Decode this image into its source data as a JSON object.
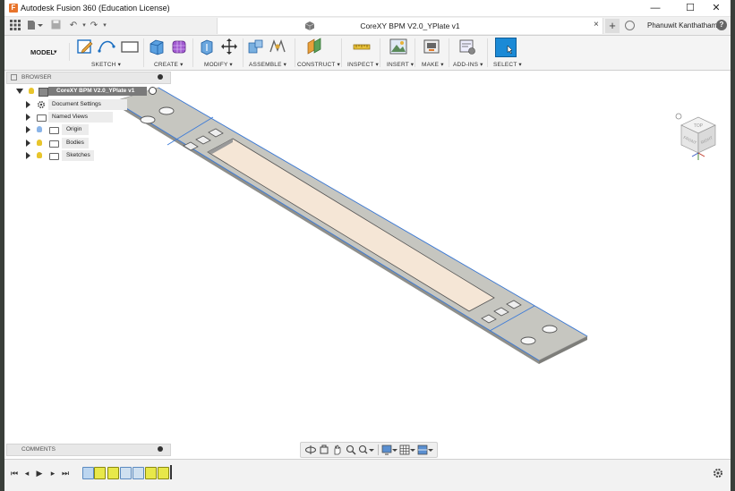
{
  "window": {
    "title": "Autodesk Fusion 360 (Education License)",
    "app_logo": "F",
    "minimize": "—",
    "maximize": "☐",
    "close": "✕"
  },
  "tabbar": {
    "document_title": "CoreXY BPM V2.0_YPlate v1",
    "close_tab": "×",
    "user_name": "Phanuwit Kanthatham",
    "help": "?"
  },
  "toolbar": {
    "workspace": "MODEL",
    "groups": [
      "SKETCH",
      "CREATE",
      "MODIFY",
      "ASSEMBLE",
      "CONSTRUCT",
      "INSPECT",
      "INSERT",
      "MAKE",
      "ADD-INS",
      "SELECT"
    ]
  },
  "browser": {
    "title": "BROWSER",
    "root": "CoreXY BPM V2.0_YPlate v1",
    "items": [
      {
        "label": "Document Settings",
        "icon": "gear-icon"
      },
      {
        "label": "Named Views",
        "icon": "folder-icon"
      },
      {
        "label": "Origin",
        "icon": "folder-icon"
      },
      {
        "label": "Bodies",
        "icon": "folder-icon"
      },
      {
        "label": "Sketches",
        "icon": "folder-icon"
      }
    ]
  },
  "comments": {
    "title": "COMMENTS"
  },
  "viewcube": {
    "top": "TOP",
    "front": "FRONT",
    "right": "RIGHT"
  },
  "colors": {
    "accent": "#0696d7",
    "plate_face": "#c6c6c0",
    "plate_edge": "#3c7bd8",
    "select_btn": "#1b8ad6"
  }
}
